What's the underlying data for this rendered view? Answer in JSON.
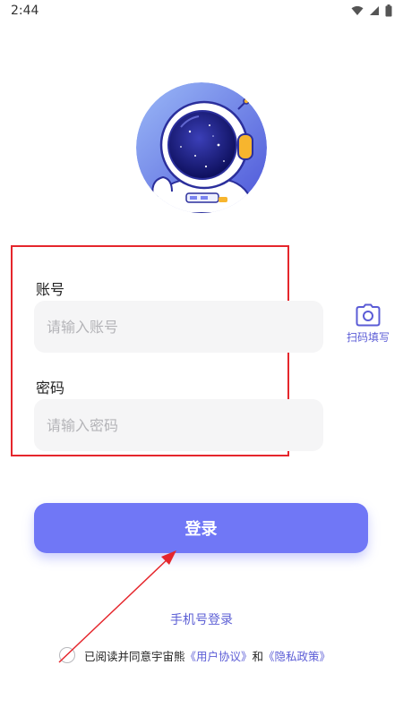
{
  "status_bar": {
    "time": "2:44",
    "icons": [
      "wifi-icon",
      "signal-icon",
      "battery-icon"
    ]
  },
  "login_form": {
    "account_label": "账号",
    "account_placeholder": "请输入账号",
    "password_label": "密码",
    "password_placeholder": "请输入密码"
  },
  "scan_fill": {
    "label": "扫码填写",
    "icon": "camera-icon"
  },
  "login_button": "登录",
  "phone_login": "手机号登录",
  "agreement": {
    "prefix": "已阅读并同意宇宙熊",
    "user_agreement": "《用户协议》",
    "conjunction": "和",
    "privacy_policy": "《隐私政策》"
  },
  "colors": {
    "accent": "#7077f6",
    "link": "#5b5cd6",
    "annotation": "#e5262c",
    "input_bg": "#f5f5f6"
  }
}
